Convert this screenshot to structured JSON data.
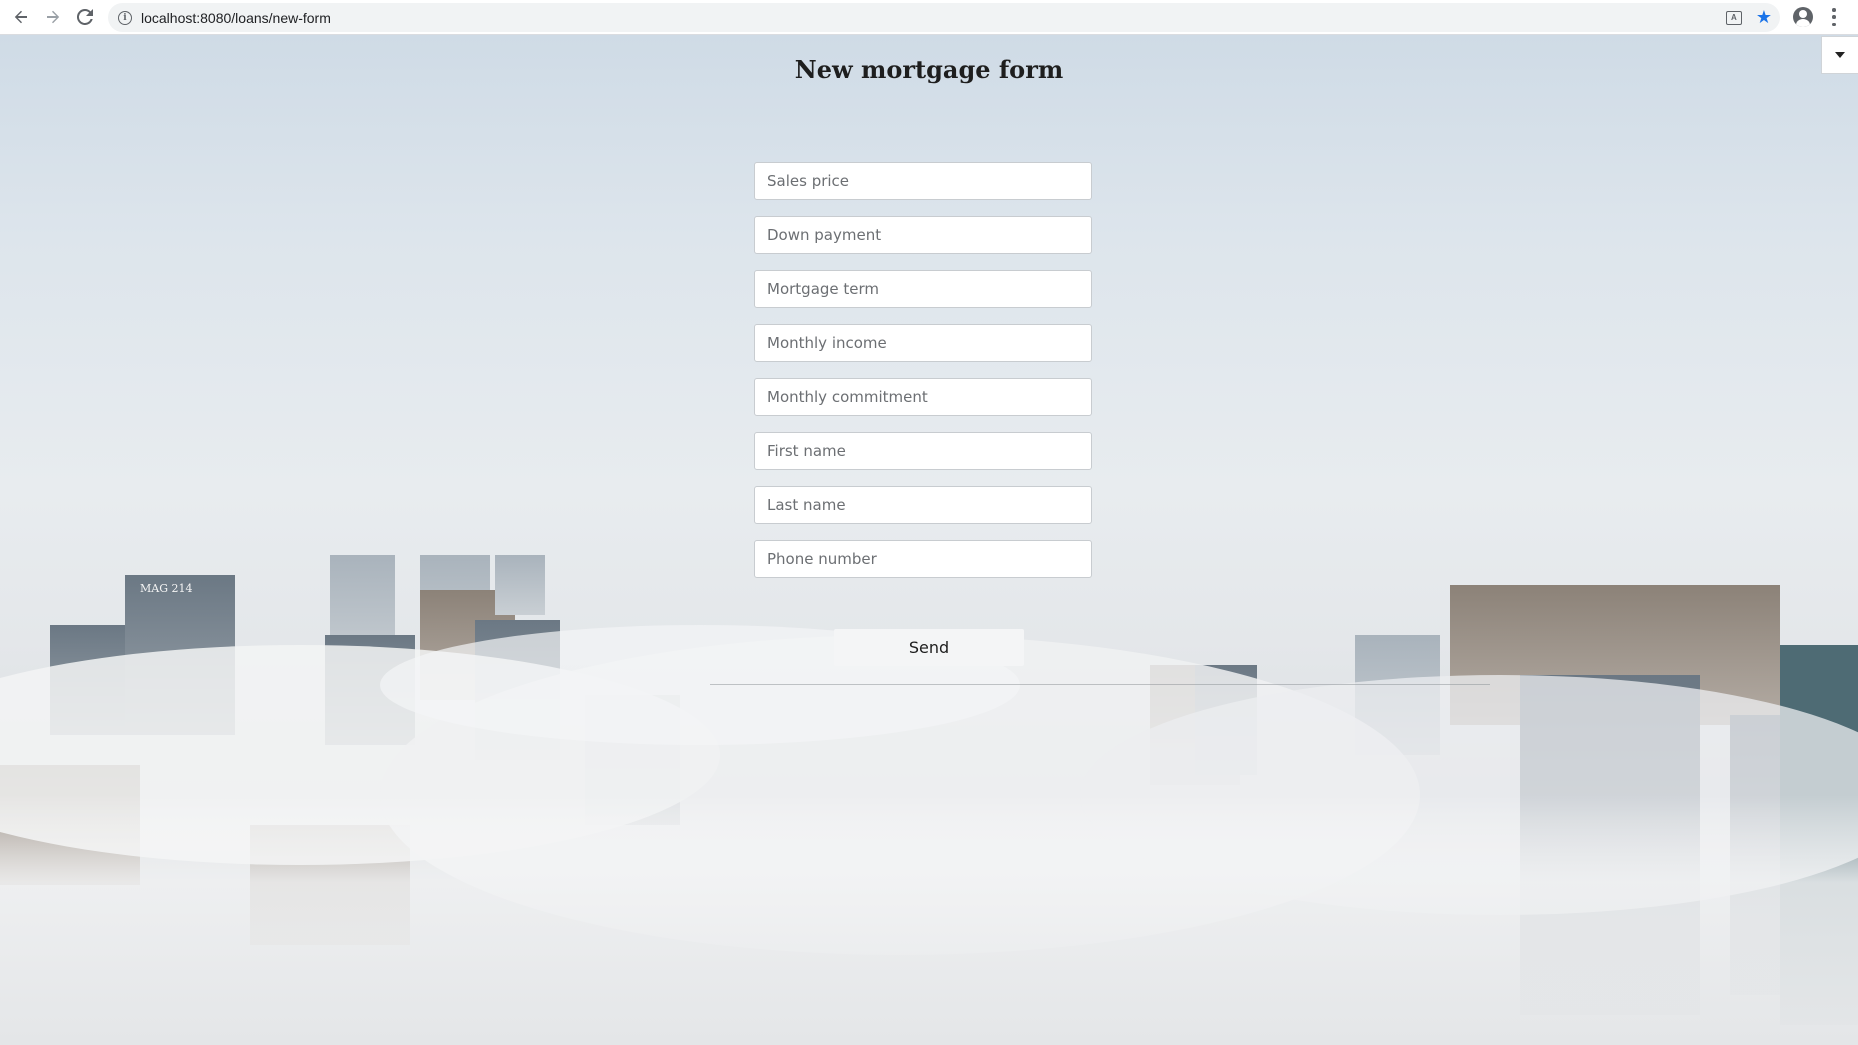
{
  "browser": {
    "url": "localhost:8080/loans/new-form"
  },
  "page": {
    "title": "New mortgage form"
  },
  "form": {
    "fields": [
      {
        "placeholder": "Sales price",
        "value": ""
      },
      {
        "placeholder": "Down payment",
        "value": ""
      },
      {
        "placeholder": "Mortgage term",
        "value": ""
      },
      {
        "placeholder": "Monthly income",
        "value": ""
      },
      {
        "placeholder": "Monthly commitment",
        "value": ""
      },
      {
        "placeholder": "First name",
        "value": ""
      },
      {
        "placeholder": "Last name",
        "value": ""
      },
      {
        "placeholder": "Phone number",
        "value": ""
      }
    ],
    "submit_label": "Send"
  },
  "building_sign": "MAG 214",
  "icons": {
    "back": "arrow-left-icon",
    "forward": "arrow-right-icon",
    "reload": "reload-icon",
    "site_info": "info-icon",
    "translate": "translate-icon",
    "bookmark": "star-icon",
    "profile": "account-circle-icon",
    "menu": "more-vertical-icon",
    "dropdown": "caret-down-icon"
  },
  "colors": {
    "star": "#1a73e8",
    "sky_top": "#cfdbe6",
    "fog": "#e8ecef"
  }
}
